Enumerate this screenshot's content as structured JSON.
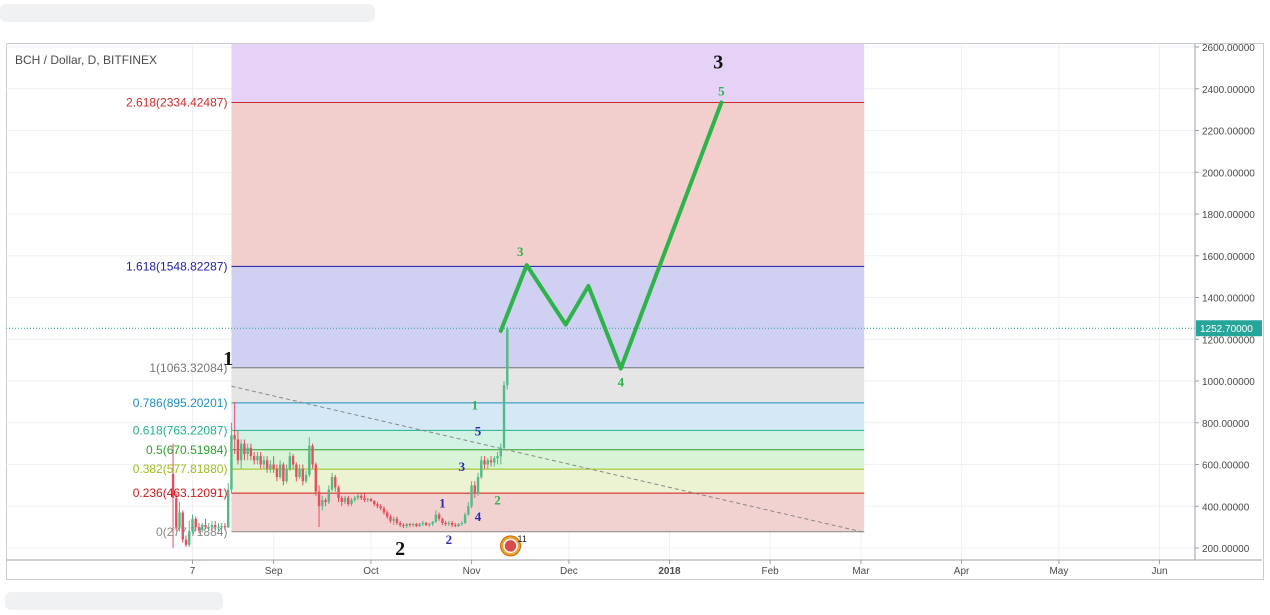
{
  "chart_data": {
    "type": "line",
    "title": "BCH / Dollar, D, BITFINEX",
    "y_axis": {
      "ticks": [
        "2600.00000",
        "2400.00000",
        "2200.00000",
        "2000.00000",
        "1800.00000",
        "1600.00000",
        "1400.00000",
        "1200.00000",
        "1000.00000",
        "800.00000",
        "600.00000",
        "400.00000",
        "200.00000"
      ],
      "tick_values": [
        2600,
        2400,
        2200,
        2000,
        1800,
        1600,
        1400,
        1200,
        1000,
        800,
        600,
        400,
        200
      ],
      "ylim": [
        170,
        2650
      ]
    },
    "x_axis": {
      "ticks": [
        {
          "label": "7",
          "date": "2017-08-07"
        },
        {
          "label": "Sep",
          "date": "2017-09-01"
        },
        {
          "label": "Oct",
          "date": "2017-10-01"
        },
        {
          "label": "Nov",
          "date": "2017-11-01"
        },
        {
          "label": "Dec",
          "date": "2017-12-01"
        },
        {
          "label": "2018",
          "date": "2018-01-01"
        },
        {
          "label": "Feb",
          "date": "2018-02-01"
        },
        {
          "label": "Mar",
          "date": "2018-03-01"
        },
        {
          "label": "Apr",
          "date": "2018-04-01"
        },
        {
          "label": "May",
          "date": "2018-05-01"
        },
        {
          "label": "Jun",
          "date": "2018-06-01"
        }
      ],
      "xlim": [
        "2017-07-28",
        "2018-06-23"
      ]
    },
    "current_price": {
      "label": "1252.70000",
      "value": 1252.7,
      "color": "#26a69a"
    },
    "fibonacci": {
      "start_date": "2017-08-19",
      "end_date": "2018-03-02",
      "levels": [
        {
          "label": "2.618(2334.42487)",
          "value": 2334.42487,
          "color": "#cc2a2a",
          "fill": "#f2cfcc"
        },
        {
          "label": "1.618(1548.82287)",
          "value": 1548.82287,
          "color": "#1e1eaa",
          "fill": "#d0d0f2"
        },
        {
          "label": "1(1063.32084)",
          "value": 1063.32084,
          "color": "#777777",
          "fill": "#e5e5e5"
        },
        {
          "label": "0.786(895.20201)",
          "value": 895.20201,
          "color": "#1e8fc2",
          "fill": "#d4e9f5"
        },
        {
          "label": "0.618(763.22087)",
          "value": 763.22087,
          "color": "#22b08a",
          "fill": "#d2f2e4"
        },
        {
          "label": "0.5(670.51984)",
          "value": 670.51984,
          "color": "#2ca02c",
          "fill": "#d9f3d6"
        },
        {
          "label": "0.382(577.81880)",
          "value": 577.8188,
          "color": "#9abf1e",
          "fill": "#ebf3d3"
        },
        {
          "label": "0.236(463.12091)",
          "value": 463.12091,
          "color": "#d01818",
          "fill": "#f2d2d0"
        },
        {
          "label": "0(277.71884)",
          "value": 277.71884,
          "color": "#888888",
          "fill": "#f4d4d2"
        }
      ],
      "top_fill": "#e6d2f6"
    },
    "trendline": {
      "from": {
        "date": "2017-08-19",
        "value": 975
      },
      "to": {
        "date": "2018-03-02",
        "value": 275
      },
      "color": "#888888",
      "style": "dashed"
    },
    "projection": {
      "color": "#2db34a",
      "points": [
        {
          "date": "2017-11-10",
          "value": 1240
        },
        {
          "date": "2017-11-18",
          "value": 1555
        },
        {
          "date": "2017-11-30",
          "value": 1270
        },
        {
          "date": "2017-12-07",
          "value": 1455
        },
        {
          "date": "2017-12-17",
          "value": 1060
        },
        {
          "date": "2018-01-17",
          "value": 2334
        }
      ]
    },
    "candles": [
      {
        "date": "2017-08-01",
        "o": 555,
        "h": 700,
        "l": 200,
        "c": 440
      },
      {
        "date": "2017-08-02",
        "o": 440,
        "h": 460,
        "l": 280,
        "c": 300
      },
      {
        "date": "2017-08-03",
        "o": 300,
        "h": 420,
        "l": 280,
        "c": 370
      },
      {
        "date": "2017-08-04",
        "o": 370,
        "h": 380,
        "l": 225,
        "c": 240
      },
      {
        "date": "2017-08-05",
        "o": 240,
        "h": 260,
        "l": 205,
        "c": 215
      },
      {
        "date": "2017-08-06",
        "o": 215,
        "h": 330,
        "l": 205,
        "c": 280
      },
      {
        "date": "2017-08-07",
        "o": 280,
        "h": 360,
        "l": 270,
        "c": 340
      },
      {
        "date": "2017-08-08",
        "o": 340,
        "h": 350,
        "l": 280,
        "c": 300
      },
      {
        "date": "2017-08-09",
        "o": 300,
        "h": 320,
        "l": 270,
        "c": 285
      },
      {
        "date": "2017-08-10",
        "o": 285,
        "h": 320,
        "l": 275,
        "c": 310
      },
      {
        "date": "2017-08-11",
        "o": 310,
        "h": 340,
        "l": 290,
        "c": 300
      },
      {
        "date": "2017-08-12",
        "o": 300,
        "h": 320,
        "l": 285,
        "c": 300
      },
      {
        "date": "2017-08-13",
        "o": 300,
        "h": 330,
        "l": 280,
        "c": 310
      },
      {
        "date": "2017-08-14",
        "o": 310,
        "h": 330,
        "l": 285,
        "c": 300
      },
      {
        "date": "2017-08-15",
        "o": 300,
        "h": 320,
        "l": 280,
        "c": 300
      },
      {
        "date": "2017-08-16",
        "o": 300,
        "h": 320,
        "l": 290,
        "c": 305
      },
      {
        "date": "2017-08-17",
        "o": 305,
        "h": 320,
        "l": 285,
        "c": 300
      },
      {
        "date": "2017-08-18",
        "o": 300,
        "h": 510,
        "l": 295,
        "c": 480
      },
      {
        "date": "2017-08-19",
        "o": 480,
        "h": 800,
        "l": 460,
        "c": 740
      },
      {
        "date": "2017-08-20",
        "o": 740,
        "h": 900,
        "l": 650,
        "c": 720
      },
      {
        "date": "2017-08-21",
        "o": 720,
        "h": 760,
        "l": 600,
        "c": 620
      },
      {
        "date": "2017-08-22",
        "o": 620,
        "h": 720,
        "l": 580,
        "c": 700
      },
      {
        "date": "2017-08-23",
        "o": 700,
        "h": 720,
        "l": 620,
        "c": 650
      },
      {
        "date": "2017-08-24",
        "o": 650,
        "h": 700,
        "l": 620,
        "c": 680
      },
      {
        "date": "2017-08-25",
        "o": 680,
        "h": 700,
        "l": 620,
        "c": 640
      },
      {
        "date": "2017-08-26",
        "o": 640,
        "h": 660,
        "l": 600,
        "c": 620
      },
      {
        "date": "2017-08-27",
        "o": 620,
        "h": 660,
        "l": 600,
        "c": 640
      },
      {
        "date": "2017-08-28",
        "o": 640,
        "h": 660,
        "l": 580,
        "c": 600
      },
      {
        "date": "2017-08-29",
        "o": 600,
        "h": 640,
        "l": 580,
        "c": 620
      },
      {
        "date": "2017-08-30",
        "o": 620,
        "h": 640,
        "l": 560,
        "c": 580
      },
      {
        "date": "2017-08-31",
        "o": 580,
        "h": 620,
        "l": 560,
        "c": 600
      },
      {
        "date": "2017-09-01",
        "o": 600,
        "h": 640,
        "l": 560,
        "c": 580
      },
      {
        "date": "2017-09-02",
        "o": 580,
        "h": 600,
        "l": 520,
        "c": 540
      },
      {
        "date": "2017-09-03",
        "o": 540,
        "h": 620,
        "l": 530,
        "c": 600
      },
      {
        "date": "2017-09-04",
        "o": 600,
        "h": 610,
        "l": 500,
        "c": 520
      },
      {
        "date": "2017-09-05",
        "o": 520,
        "h": 600,
        "l": 510,
        "c": 580
      },
      {
        "date": "2017-09-06",
        "o": 580,
        "h": 660,
        "l": 570,
        "c": 640
      },
      {
        "date": "2017-09-07",
        "o": 640,
        "h": 650,
        "l": 580,
        "c": 600
      },
      {
        "date": "2017-09-08",
        "o": 600,
        "h": 610,
        "l": 520,
        "c": 540
      },
      {
        "date": "2017-09-09",
        "o": 540,
        "h": 600,
        "l": 530,
        "c": 580
      },
      {
        "date": "2017-09-10",
        "o": 580,
        "h": 600,
        "l": 500,
        "c": 520
      },
      {
        "date": "2017-09-11",
        "o": 520,
        "h": 570,
        "l": 510,
        "c": 550
      },
      {
        "date": "2017-09-12",
        "o": 550,
        "h": 730,
        "l": 540,
        "c": 690
      },
      {
        "date": "2017-09-13",
        "o": 690,
        "h": 700,
        "l": 580,
        "c": 600
      },
      {
        "date": "2017-09-14",
        "o": 600,
        "h": 610,
        "l": 450,
        "c": 470
      },
      {
        "date": "2017-09-15",
        "o": 470,
        "h": 500,
        "l": 300,
        "c": 400
      },
      {
        "date": "2017-09-16",
        "o": 400,
        "h": 450,
        "l": 380,
        "c": 430
      },
      {
        "date": "2017-09-17",
        "o": 430,
        "h": 440,
        "l": 400,
        "c": 420
      },
      {
        "date": "2017-09-18",
        "o": 420,
        "h": 500,
        "l": 410,
        "c": 480
      },
      {
        "date": "2017-09-19",
        "o": 480,
        "h": 560,
        "l": 470,
        "c": 540
      },
      {
        "date": "2017-09-20",
        "o": 540,
        "h": 550,
        "l": 470,
        "c": 490
      },
      {
        "date": "2017-09-21",
        "o": 490,
        "h": 500,
        "l": 420,
        "c": 440
      },
      {
        "date": "2017-09-22",
        "o": 440,
        "h": 450,
        "l": 400,
        "c": 420
      },
      {
        "date": "2017-09-23",
        "o": 420,
        "h": 450,
        "l": 410,
        "c": 440
      },
      {
        "date": "2017-09-24",
        "o": 440,
        "h": 450,
        "l": 400,
        "c": 410
      },
      {
        "date": "2017-09-25",
        "o": 410,
        "h": 440,
        "l": 400,
        "c": 430
      },
      {
        "date": "2017-09-26",
        "o": 430,
        "h": 450,
        "l": 420,
        "c": 440
      },
      {
        "date": "2017-09-27",
        "o": 440,
        "h": 460,
        "l": 430,
        "c": 450
      },
      {
        "date": "2017-09-28",
        "o": 450,
        "h": 460,
        "l": 430,
        "c": 440
      },
      {
        "date": "2017-09-29",
        "o": 440,
        "h": 460,
        "l": 420,
        "c": 430
      },
      {
        "date": "2017-09-30",
        "o": 430,
        "h": 440,
        "l": 420,
        "c": 435
      },
      {
        "date": "2017-10-01",
        "o": 435,
        "h": 440,
        "l": 420,
        "c": 425
      },
      {
        "date": "2017-10-02",
        "o": 425,
        "h": 430,
        "l": 400,
        "c": 410
      },
      {
        "date": "2017-10-03",
        "o": 410,
        "h": 420,
        "l": 390,
        "c": 400
      },
      {
        "date": "2017-10-04",
        "o": 400,
        "h": 410,
        "l": 380,
        "c": 390
      },
      {
        "date": "2017-10-05",
        "o": 390,
        "h": 400,
        "l": 360,
        "c": 370
      },
      {
        "date": "2017-10-06",
        "o": 370,
        "h": 380,
        "l": 340,
        "c": 350
      },
      {
        "date": "2017-10-07",
        "o": 350,
        "h": 360,
        "l": 320,
        "c": 330
      },
      {
        "date": "2017-10-08",
        "o": 330,
        "h": 350,
        "l": 310,
        "c": 340
      },
      {
        "date": "2017-10-09",
        "o": 340,
        "h": 350,
        "l": 310,
        "c": 320
      },
      {
        "date": "2017-10-10",
        "o": 320,
        "h": 330,
        "l": 300,
        "c": 310
      },
      {
        "date": "2017-10-11",
        "o": 310,
        "h": 320,
        "l": 295,
        "c": 305
      },
      {
        "date": "2017-10-12",
        "o": 305,
        "h": 320,
        "l": 295,
        "c": 315
      },
      {
        "date": "2017-10-13",
        "o": 315,
        "h": 320,
        "l": 300,
        "c": 310
      },
      {
        "date": "2017-10-14",
        "o": 310,
        "h": 320,
        "l": 300,
        "c": 315
      },
      {
        "date": "2017-10-15",
        "o": 315,
        "h": 320,
        "l": 300,
        "c": 305
      },
      {
        "date": "2017-10-16",
        "o": 305,
        "h": 320,
        "l": 300,
        "c": 315
      },
      {
        "date": "2017-10-17",
        "o": 315,
        "h": 330,
        "l": 305,
        "c": 320
      },
      {
        "date": "2017-10-18",
        "o": 320,
        "h": 325,
        "l": 305,
        "c": 310
      },
      {
        "date": "2017-10-19",
        "o": 310,
        "h": 320,
        "l": 300,
        "c": 315
      },
      {
        "date": "2017-10-20",
        "o": 315,
        "h": 330,
        "l": 305,
        "c": 325
      },
      {
        "date": "2017-10-21",
        "o": 325,
        "h": 380,
        "l": 320,
        "c": 360
      },
      {
        "date": "2017-10-22",
        "o": 360,
        "h": 370,
        "l": 330,
        "c": 340
      },
      {
        "date": "2017-10-23",
        "o": 340,
        "h": 345,
        "l": 310,
        "c": 320
      },
      {
        "date": "2017-10-24",
        "o": 320,
        "h": 330,
        "l": 305,
        "c": 315
      },
      {
        "date": "2017-10-25",
        "o": 315,
        "h": 330,
        "l": 305,
        "c": 320
      },
      {
        "date": "2017-10-26",
        "o": 320,
        "h": 330,
        "l": 300,
        "c": 310
      },
      {
        "date": "2017-10-27",
        "o": 310,
        "h": 320,
        "l": 300,
        "c": 305
      },
      {
        "date": "2017-10-28",
        "o": 305,
        "h": 320,
        "l": 300,
        "c": 315
      },
      {
        "date": "2017-10-29",
        "o": 315,
        "h": 330,
        "l": 305,
        "c": 320
      },
      {
        "date": "2017-10-30",
        "o": 320,
        "h": 370,
        "l": 315,
        "c": 360
      },
      {
        "date": "2017-10-31",
        "o": 360,
        "h": 420,
        "l": 355,
        "c": 400
      },
      {
        "date": "2017-11-01",
        "o": 400,
        "h": 520,
        "l": 390,
        "c": 500
      },
      {
        "date": "2017-11-02",
        "o": 500,
        "h": 520,
        "l": 440,
        "c": 460
      },
      {
        "date": "2017-11-03",
        "o": 460,
        "h": 560,
        "l": 450,
        "c": 540
      },
      {
        "date": "2017-11-04",
        "o": 540,
        "h": 640,
        "l": 530,
        "c": 620
      },
      {
        "date": "2017-11-05",
        "o": 620,
        "h": 640,
        "l": 580,
        "c": 600
      },
      {
        "date": "2017-11-06",
        "o": 600,
        "h": 630,
        "l": 580,
        "c": 620
      },
      {
        "date": "2017-11-07",
        "o": 620,
        "h": 640,
        "l": 590,
        "c": 610
      },
      {
        "date": "2017-11-08",
        "o": 610,
        "h": 640,
        "l": 590,
        "c": 630
      },
      {
        "date": "2017-11-09",
        "o": 630,
        "h": 660,
        "l": 600,
        "c": 640
      },
      {
        "date": "2017-11-10",
        "o": 640,
        "h": 700,
        "l": 600,
        "c": 680
      },
      {
        "date": "2017-11-11",
        "o": 680,
        "h": 1000,
        "l": 670,
        "c": 980
      },
      {
        "date": "2017-11-12",
        "o": 980,
        "h": 1260,
        "l": 960,
        "c": 1250
      }
    ],
    "wave_labels": [
      {
        "text": "3",
        "date": "2018-01-16",
        "value": 2530,
        "color": "#111111",
        "size": 20
      },
      {
        "text": "5",
        "date": "2018-01-17",
        "value": 2390,
        "color": "#2db34a",
        "size": 13
      },
      {
        "text": "3",
        "date": "2017-11-16",
        "value": 1620,
        "color": "#2db34a",
        "size": 13
      },
      {
        "text": "4",
        "date": "2017-12-17",
        "value": 995,
        "color": "#2db34a",
        "size": 13
      },
      {
        "text": "1",
        "date": "2017-08-18",
        "value": 1110,
        "color": "#111111",
        "size": 20
      },
      {
        "text": "2",
        "date": "2017-10-10",
        "value": 200,
        "color": "#111111",
        "size": 20
      },
      {
        "text": "1",
        "date": "2017-10-23",
        "value": 415,
        "color": "#2a2ab0",
        "size": 13
      },
      {
        "text": "2",
        "date": "2017-10-25",
        "value": 240,
        "color": "#2a2ab0",
        "size": 13
      },
      {
        "text": "3",
        "date": "2017-10-29",
        "value": 590,
        "color": "#2a2ab0",
        "size": 13
      },
      {
        "text": "4",
        "date": "2017-11-03",
        "value": 350,
        "color": "#2a2ab0",
        "size": 13
      },
      {
        "text": "5",
        "date": "2017-11-03",
        "value": 760,
        "color": "#2a2ab0",
        "size": 13
      },
      {
        "text": "1",
        "date": "2017-11-02",
        "value": 885,
        "color": "#2db34a",
        "size": 13
      },
      {
        "text": "2",
        "date": "2017-11-09",
        "value": 430,
        "color": "#2db34a",
        "size": 13
      }
    ],
    "event_badge": {
      "date": "2017-11-13",
      "value": 210,
      "label": "11"
    },
    "grid": true,
    "axis_position": "right"
  }
}
